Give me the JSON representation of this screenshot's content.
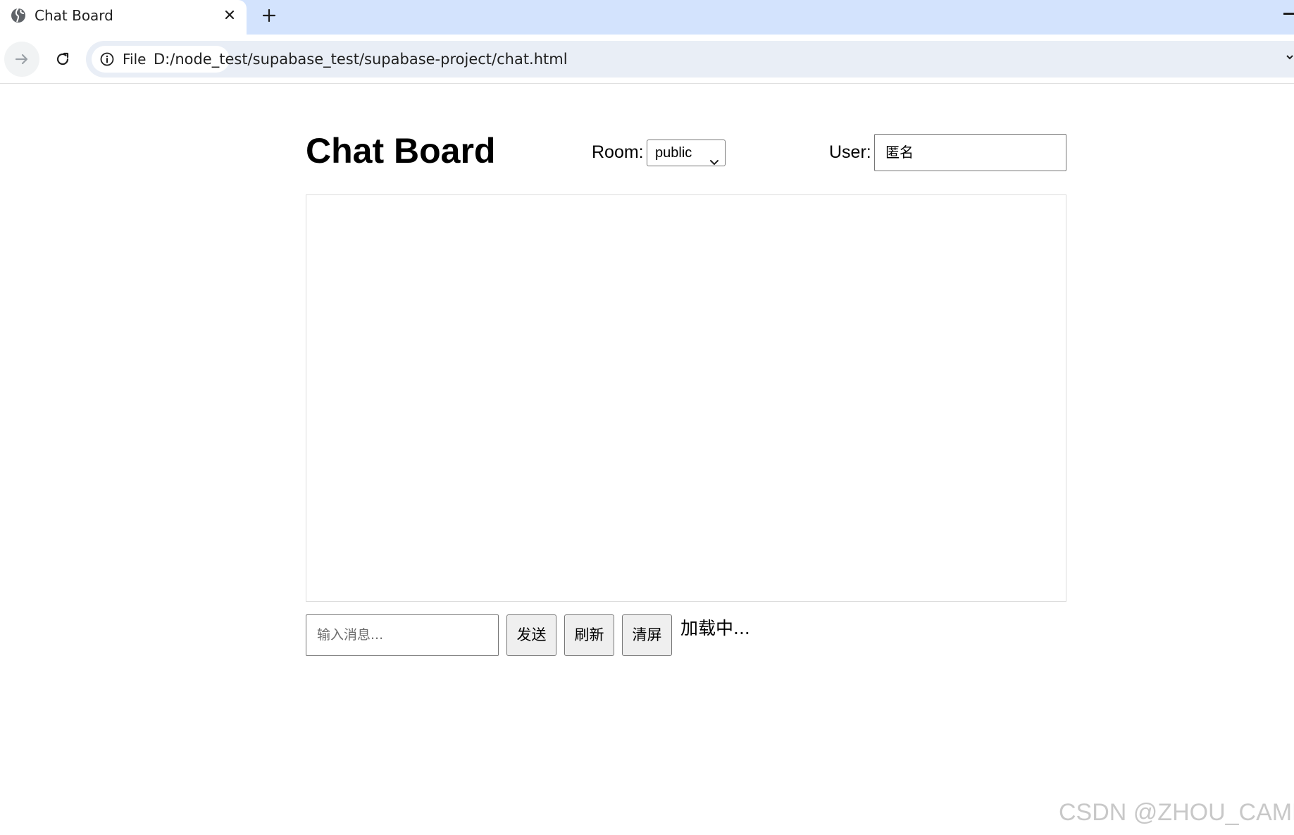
{
  "browser": {
    "tab_title": "Chat Board",
    "address_chip": "File",
    "url": "D:/node_test/supabase_test/supabase-project/chat.html"
  },
  "page": {
    "title": "Chat Board",
    "room_label": "Room:",
    "room_selected": "public",
    "user_label": "User:",
    "user_value": "匿名",
    "message_placeholder": "输入消息...",
    "send_label": "发送",
    "refresh_label": "刷新",
    "clear_label": "清屏",
    "status": "加载中..."
  },
  "watermark": "CSDN @ZHOU_CAMP",
  "icons": {
    "tab": "globe-icon",
    "close": "close-icon",
    "new_tab": "plus-icon",
    "forward": "arrow-right-icon",
    "reload": "reload-icon",
    "info": "info-icon",
    "select": "chevron-down-icon"
  },
  "colors": {
    "tabstrip": "#d3e3fd",
    "omnibox": "#e9eef6",
    "button_bg": "#efefef",
    "chat_border": "#dcdcdc"
  }
}
